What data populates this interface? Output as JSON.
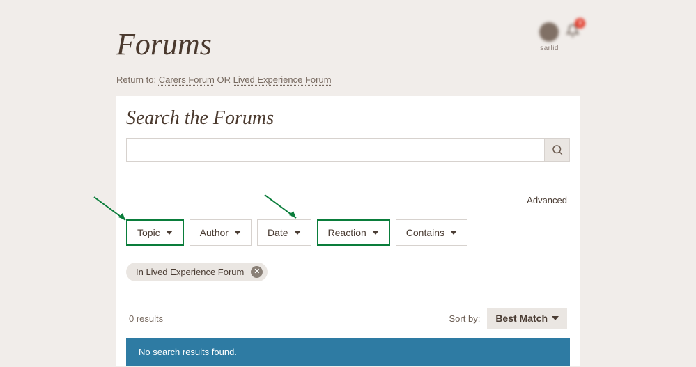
{
  "header": {
    "title": "Forums",
    "notification_count": "3",
    "avatar_name": "sarlid"
  },
  "breadcrumb": {
    "prefix": "Return to: ",
    "link1": "Carers Forum",
    "sep": " OR ",
    "link2": "Lived Experience Forum"
  },
  "search": {
    "title": "Search the Forums",
    "value": "",
    "advanced": "Advanced"
  },
  "filters": {
    "topic": "Topic",
    "author": "Author",
    "date": "Date",
    "reaction": "Reaction",
    "contains": "Contains"
  },
  "chip": {
    "label": "In Lived Experience Forum"
  },
  "results": {
    "count": "0 results",
    "sort_label": "Sort by:",
    "sort_value": "Best Match",
    "alert": "No search results found."
  }
}
